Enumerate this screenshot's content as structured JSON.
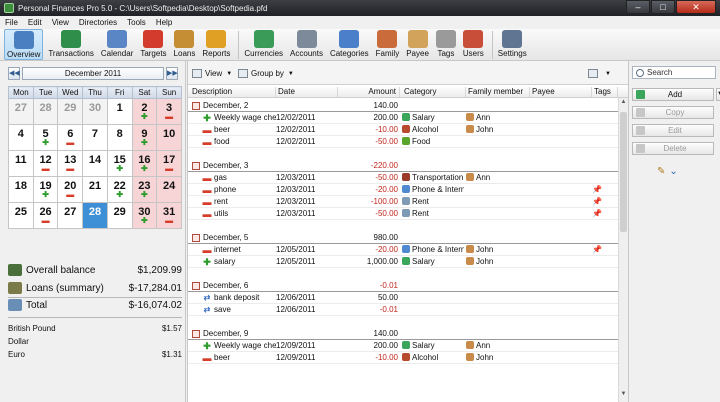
{
  "window": {
    "title": "Personal Finances Pro 5.0 - C:\\Users\\Softpedia\\Desktop\\Softpedia.pfd"
  },
  "menu": [
    "File",
    "Edit",
    "View",
    "Directories",
    "Tools",
    "Help"
  ],
  "toolbar": [
    {
      "label": "Overview",
      "icon": "overview-icon",
      "color": "#4a7fc1",
      "active": true
    },
    {
      "label": "Transactions",
      "icon": "transactions-icon",
      "color": "#2f8f4a"
    },
    {
      "label": "Calendar",
      "icon": "calendar-icon",
      "color": "#5a86c5"
    },
    {
      "label": "Targets",
      "icon": "targets-icon",
      "color": "#d33c2d"
    },
    {
      "label": "Loans",
      "icon": "loans-icon",
      "color": "#c58e34"
    },
    {
      "label": "Reports",
      "icon": "reports-icon",
      "color": "#e0a023"
    },
    {
      "sep": true
    },
    {
      "label": "Currencies",
      "icon": "currencies-icon",
      "color": "#3a9a58"
    },
    {
      "label": "Accounts",
      "icon": "accounts-icon",
      "color": "#7c8a9a"
    },
    {
      "label": "Categories",
      "icon": "categories-icon",
      "color": "#4b7fc9"
    },
    {
      "label": "Family",
      "icon": "family-icon",
      "color": "#c96b3b"
    },
    {
      "label": "Payee",
      "icon": "payee-icon",
      "color": "#d2a35a"
    },
    {
      "label": "Tags",
      "icon": "tags-icon",
      "color": "#9a9a9a"
    },
    {
      "label": "Users",
      "icon": "users-icon",
      "color": "#c94e3a"
    },
    {
      "sep": true
    },
    {
      "label": "Settings",
      "icon": "settings-icon",
      "color": "#5f7591"
    }
  ],
  "calendar": {
    "month_label": "December 2011",
    "weekdays": [
      "Mon",
      "Tue",
      "Wed",
      "Thu",
      "Fri",
      "Sat",
      "Sun"
    ],
    "weeks": [
      [
        {
          "d": "27",
          "o": 1
        },
        {
          "d": "28",
          "o": 1
        },
        {
          "d": "29",
          "o": 1
        },
        {
          "d": "30",
          "o": 1
        },
        {
          "d": "1"
        },
        {
          "d": "2",
          "m": "+"
        },
        {
          "d": "3",
          "m": "-"
        }
      ],
      [
        {
          "d": "4"
        },
        {
          "d": "5",
          "m": "+"
        },
        {
          "d": "6",
          "m": "-"
        },
        {
          "d": "7"
        },
        {
          "d": "8"
        },
        {
          "d": "9",
          "m": "+"
        },
        {
          "d": "10"
        }
      ],
      [
        {
          "d": "11"
        },
        {
          "d": "12",
          "m": "-"
        },
        {
          "d": "13",
          "m": "-"
        },
        {
          "d": "14"
        },
        {
          "d": "15",
          "m": "+"
        },
        {
          "d": "16",
          "m": "+"
        },
        {
          "d": "17",
          "m": "-"
        }
      ],
      [
        {
          "d": "18"
        },
        {
          "d": "19",
          "m": "+"
        },
        {
          "d": "20",
          "m": "-"
        },
        {
          "d": "21"
        },
        {
          "d": "22",
          "m": "+"
        },
        {
          "d": "23",
          "m": "+"
        },
        {
          "d": "24"
        }
      ],
      [
        {
          "d": "25"
        },
        {
          "d": "26",
          "m": "-"
        },
        {
          "d": "27"
        },
        {
          "d": "28",
          "today": 1
        },
        {
          "d": "29"
        },
        {
          "d": "30",
          "m": "+"
        },
        {
          "d": "31",
          "m": "-"
        }
      ]
    ]
  },
  "summary": {
    "overall_label": "Overall balance",
    "overall_value": "$1,209.99",
    "loans_label": "Loans (summary)",
    "loans_value": "$-17,284.01",
    "total_label": "Total",
    "total_value": "$-16,074.02"
  },
  "currencies": [
    {
      "name": "British Pound",
      "value": "$1.57"
    },
    {
      "name": "Dollar",
      "value": ""
    },
    {
      "name": "Euro",
      "value": "$1.31"
    }
  ],
  "main_toolbar": {
    "view_label": "View",
    "group_label": "Group by"
  },
  "columns": [
    "Description",
    "Date",
    "Amount",
    "Category",
    "Family member",
    "Payee",
    "Tags"
  ],
  "rows": [
    {
      "t": "day",
      "desc": "December, 2",
      "amount": "140.00"
    },
    {
      "t": "item",
      "pm": "+",
      "desc": "Weekly wage chec",
      "date": "12/02/2011",
      "amount": "200.00",
      "cat": "Salary",
      "cc": "#3aa55b",
      "fam": "Ann",
      "tag": ""
    },
    {
      "t": "item",
      "pm": "-",
      "desc": "beer",
      "date": "12/02/2011",
      "amount": "-10.00",
      "cat": "Alcohol",
      "cc": "#b84a2e",
      "fam": "John",
      "tag": ""
    },
    {
      "t": "item",
      "pm": "-",
      "desc": "food",
      "date": "12/02/2011",
      "amount": "-50.00",
      "cat": "Food",
      "cc": "#5aa62d",
      "fam": "",
      "tag": ""
    },
    {
      "t": "gap"
    },
    {
      "t": "day",
      "desc": "December, 3",
      "amount": "-220.00"
    },
    {
      "t": "item",
      "pm": "-",
      "desc": "gas",
      "date": "12/03/2011",
      "amount": "-50.00",
      "cat": "Transportation",
      "cc": "#9a3b2a",
      "fam": "Ann",
      "tag": ""
    },
    {
      "t": "item",
      "pm": "-",
      "desc": "phone",
      "date": "12/03/2011",
      "amount": "-20.00",
      "cat": "Phone & Intern",
      "cc": "#4f8ad0",
      "fam": "",
      "tag": "pin"
    },
    {
      "t": "item",
      "pm": "-",
      "desc": "rent",
      "date": "12/03/2011",
      "amount": "-100.00",
      "cat": "Rent",
      "cc": "#7f9ab4",
      "fam": "",
      "tag": "pin"
    },
    {
      "t": "item",
      "pm": "-",
      "desc": "utils",
      "date": "12/03/2011",
      "amount": "-50.00",
      "cat": "Rent",
      "cc": "#7f9ab4",
      "fam": "",
      "tag": "pin"
    },
    {
      "t": "gap"
    },
    {
      "t": "day",
      "desc": "December, 5",
      "amount": "980.00"
    },
    {
      "t": "item",
      "pm": "-",
      "desc": "internet",
      "date": "12/05/2011",
      "amount": "-20.00",
      "cat": "Phone & Intern",
      "cc": "#4f8ad0",
      "fam": "John",
      "tag": "pin"
    },
    {
      "t": "item",
      "pm": "+",
      "desc": "salary",
      "date": "12/05/2011",
      "amount": "1,000.00",
      "cat": "Salary",
      "cc": "#3aa55b",
      "fam": "John",
      "tag": ""
    },
    {
      "t": "gap"
    },
    {
      "t": "day",
      "desc": "December, 6",
      "amount": "-0.01"
    },
    {
      "t": "item",
      "pm": "x",
      "desc": "bank deposit",
      "date": "12/06/2011",
      "amount": "50.00",
      "cat": "",
      "cc": "",
      "fam": "",
      "tag": ""
    },
    {
      "t": "item",
      "pm": "x",
      "desc": "save",
      "date": "12/06/2011",
      "amount": "-0.01",
      "cat": "",
      "cc": "",
      "fam": "",
      "tag": ""
    },
    {
      "t": "gap"
    },
    {
      "t": "day",
      "desc": "December, 9",
      "amount": "140.00"
    },
    {
      "t": "item",
      "pm": "+",
      "desc": "Weekly wage chec",
      "date": "12/09/2011",
      "amount": "200.00",
      "cat": "Salary",
      "cc": "#3aa55b",
      "fam": "Ann",
      "tag": ""
    },
    {
      "t": "item",
      "pm": "-",
      "desc": "beer",
      "date": "12/09/2011",
      "amount": "-10.00",
      "cat": "Alcohol",
      "cc": "#b84a2e",
      "fam": "John",
      "tag": ""
    }
  ],
  "right": {
    "search_placeholder": "Search",
    "add": "Add",
    "copy": "Copy",
    "edit": "Edit",
    "delete": "Delete"
  }
}
